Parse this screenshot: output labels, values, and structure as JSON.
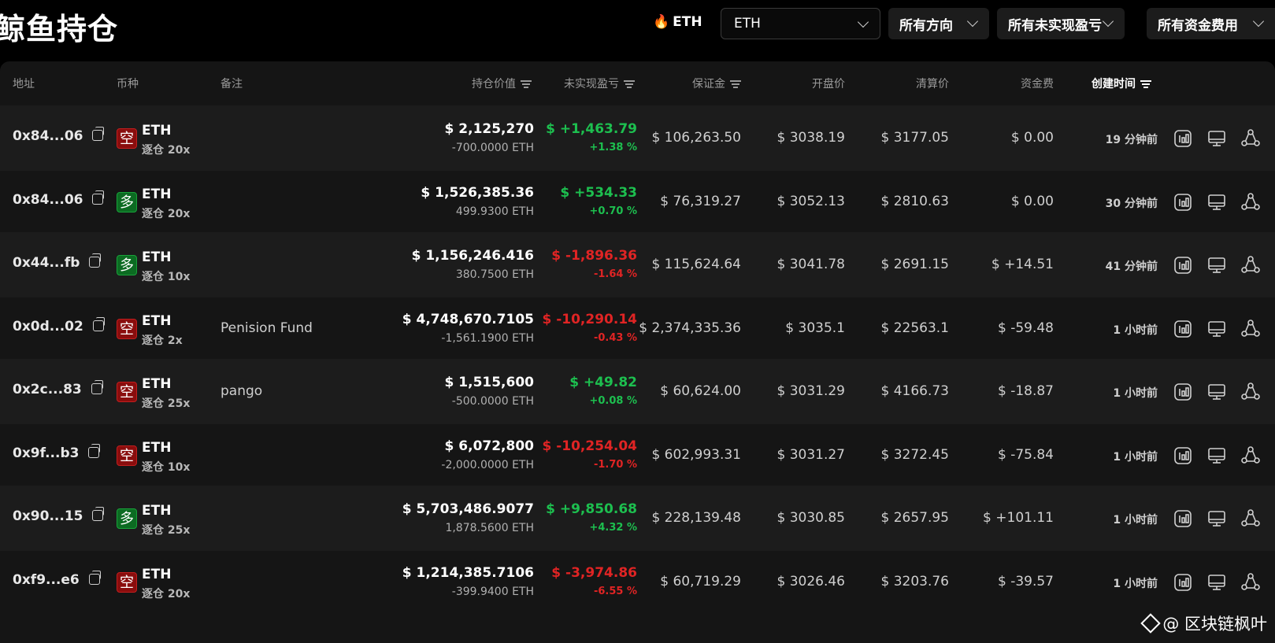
{
  "page": {
    "title": "鲸鱼持仓"
  },
  "filters": {
    "hot_label": "ETH",
    "coin_select": "ETH",
    "direction": "所有方向",
    "pnl": "所有未实现盈亏",
    "funding": "所有资金费用"
  },
  "columns": {
    "address": "地址",
    "coin": "币种",
    "note": "备注",
    "value": "持仓价值",
    "pnl": "未实现盈亏",
    "margin": "保证金",
    "open_price": "开盘价",
    "liq_price": "清算价",
    "funding": "资金费",
    "created": "创建时间"
  },
  "rows": [
    {
      "address": "0x84...06",
      "side": "short",
      "side_label": "空",
      "coin": "ETH",
      "leverage": "逐仓 20x",
      "note": "",
      "value": "$ 2,125,270",
      "qty": "-700.0000 ETH",
      "pnl": "$ +1,463.79",
      "pnl_sign": "pos",
      "pnl_pct": "+1.38 %",
      "margin": "$ 106,263.50",
      "open_price": "$ 3038.19",
      "liq_price": "$ 3177.05",
      "funding": "$ 0.00",
      "funding_sign": "zero",
      "created": "19 分钟前"
    },
    {
      "address": "0x84...06",
      "side": "long",
      "side_label": "多",
      "coin": "ETH",
      "leverage": "逐仓 20x",
      "note": "",
      "value": "$ 1,526,385.36",
      "qty": "499.9300 ETH",
      "pnl": "$ +534.33",
      "pnl_sign": "pos",
      "pnl_pct": "+0.70 %",
      "margin": "$ 76,319.27",
      "open_price": "$ 3052.13",
      "liq_price": "$ 2810.63",
      "funding": "$ 0.00",
      "funding_sign": "zero",
      "created": "30 分钟前"
    },
    {
      "address": "0x44...fb",
      "side": "long",
      "side_label": "多",
      "coin": "ETH",
      "leverage": "逐仓 10x",
      "note": "",
      "value": "$ 1,156,246.416",
      "qty": "380.7500 ETH",
      "pnl": "$ -1,896.36",
      "pnl_sign": "neg",
      "pnl_pct": "-1.64 %",
      "margin": "$ 115,624.64",
      "open_price": "$ 3041.78",
      "liq_price": "$ 2691.15",
      "funding": "$ +14.51",
      "funding_sign": "pos",
      "created": "41 分钟前"
    },
    {
      "address": "0x0d...02",
      "side": "short",
      "side_label": "空",
      "coin": "ETH",
      "leverage": "逐仓 2x",
      "note": "Penision Fund",
      "value": "$ 4,748,670.7105",
      "qty": "-1,561.1900 ETH",
      "pnl": "$ -10,290.14",
      "pnl_sign": "neg",
      "pnl_pct": "-0.43 %",
      "margin": "$ 2,374,335.36",
      "open_price": "$ 3035.1",
      "liq_price": "$ 22563.1",
      "funding": "$ -59.48",
      "funding_sign": "neg",
      "created": "1 小时前"
    },
    {
      "address": "0x2c...83",
      "side": "short",
      "side_label": "空",
      "coin": "ETH",
      "leverage": "逐仓 25x",
      "note": "pango",
      "value": "$ 1,515,600",
      "qty": "-500.0000 ETH",
      "pnl": "$ +49.82",
      "pnl_sign": "pos",
      "pnl_pct": "+0.08 %",
      "margin": "$ 60,624.00",
      "open_price": "$ 3031.29",
      "liq_price": "$ 4166.73",
      "funding": "$ -18.87",
      "funding_sign": "neg",
      "created": "1 小时前"
    },
    {
      "address": "0x9f...b3",
      "side": "short",
      "side_label": "空",
      "coin": "ETH",
      "leverage": "逐仓 10x",
      "note": "",
      "value": "$ 6,072,800",
      "qty": "-2,000.0000 ETH",
      "pnl": "$ -10,254.04",
      "pnl_sign": "neg",
      "pnl_pct": "-1.70 %",
      "margin": "$ 602,993.31",
      "open_price": "$ 3031.27",
      "liq_price": "$ 3272.45",
      "funding": "$ -75.84",
      "funding_sign": "neg",
      "created": "1 小时前"
    },
    {
      "address": "0x90...15",
      "side": "long",
      "side_label": "多",
      "coin": "ETH",
      "leverage": "逐仓 25x",
      "note": "",
      "value": "$ 5,703,486.9077",
      "qty": "1,878.5600 ETH",
      "pnl": "$ +9,850.68",
      "pnl_sign": "pos",
      "pnl_pct": "+4.32 %",
      "margin": "$ 228,139.48",
      "open_price": "$ 3030.85",
      "liq_price": "$ 2657.95",
      "funding": "$ +101.11",
      "funding_sign": "pos",
      "created": "1 小时前"
    },
    {
      "address": "0xf9...e6",
      "side": "short",
      "side_label": "空",
      "coin": "ETH",
      "leverage": "逐仓 20x",
      "note": "",
      "value": "$ 1,214,385.7106",
      "qty": "-399.9400 ETH",
      "pnl": "$ -3,974.86",
      "pnl_sign": "neg",
      "pnl_pct": "-6.55 %",
      "margin": "$ 60,719.29",
      "open_price": "$ 3026.46",
      "liq_price": "$ 3203.76",
      "funding": "$ -39.57",
      "funding_sign": "neg",
      "created": "1 小时前"
    }
  ],
  "icons": {
    "row_actions": [
      "chart-icon",
      "monitor-icon",
      "share-icon"
    ]
  },
  "colors": {
    "positive": "#1dbf4f",
    "negative": "#e02424",
    "short_badge": "#8a0d0d",
    "long_badge": "#0c6b22"
  },
  "watermark": {
    "text": "@ 区块链枫叶"
  }
}
